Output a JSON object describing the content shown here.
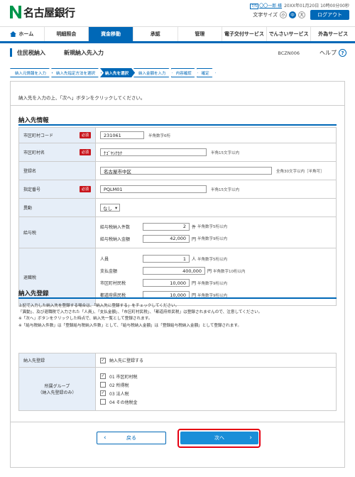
{
  "header": {
    "bank_name": "名古屋銀行",
    "user_tag": "7/5",
    "user_name": "〇〇一郎 様",
    "last_login": "20XX年01月20日 10時00分00秒",
    "font_size_label": "文字サイズ",
    "font_sizes": [
      "小",
      "中",
      "大"
    ],
    "logout": "ログアウト"
  },
  "gnav": [
    {
      "label": "ホーム",
      "icon": "home-icon"
    },
    {
      "label": "明細照会"
    },
    {
      "label": "資金移動"
    },
    {
      "label": "承認"
    },
    {
      "label": "管理"
    },
    {
      "label": "電子交付サービス"
    },
    {
      "label": "でんさいサービス"
    },
    {
      "label": "外為サービス"
    }
  ],
  "page": {
    "category": "住民税納入",
    "title": "新規納入先入力",
    "screen_id": "BCZN006",
    "help": "ヘルプ"
  },
  "steps": [
    "納入元情報を入力",
    "納入先指定方法を選択",
    "納入先を選択",
    "納入金額を入力",
    "内容確認",
    "確定"
  ],
  "instruction": "納入先を入力の上、「次へ」ボタンをクリックしてください。",
  "section1": {
    "title": "納入先情報",
    "required": "必須",
    "city_code": {
      "label": "市区町村コード",
      "value": "231061",
      "hint": "半角数字6桁"
    },
    "city_name": {
      "label": "市区町村名",
      "value": "ﾅｺﾞﾔｼﾅｶｸ",
      "hint": "半角15文字以内"
    },
    "registered_name": {
      "label": "登録名",
      "value": "名古屋市中区",
      "hint": "全角30文字以内［半角可］"
    },
    "designated_no": {
      "label": "指定番号",
      "value": "PQLM01",
      "hint": "半角15文字以内"
    },
    "transfer": {
      "label": "異動",
      "value": "なし"
    },
    "salary_tax": {
      "label": "給与税",
      "count_label": "給与税納入件数",
      "count_value": "2",
      "count_unit": "件",
      "count_hint": "半角数字5桁以内",
      "amount_label": "給与税納入金額",
      "amount_value": "42,000",
      "amount_unit": "円",
      "amount_hint": "半角数字9桁以内"
    },
    "retirement_tax": {
      "label": "退職税",
      "people_label": "人員",
      "people_value": "1",
      "people_unit": "人",
      "people_hint": "半角数字5桁以内",
      "paid_label": "支払金額",
      "paid_value": "400,000",
      "paid_unit": "円",
      "paid_hint": "半角数字10桁以内",
      "city_tax_label": "市区町村民税",
      "city_tax_value": "10,000",
      "city_tax_unit": "円",
      "city_tax_hint": "半角数字9桁以内",
      "pref_tax_label": "都道府県民税",
      "pref_tax_value": "10,000",
      "pref_tax_unit": "円",
      "pref_tax_hint": "半角数字9桁以内"
    }
  },
  "section2": {
    "title": "納入先登録",
    "notes": [
      "上記で入力した納入先を登録する場合は、「納入先に登録する」をチェックしてください。",
      "「異動」、及び退職税で入力された「人員」、「支払金額」、「市区町村民税」、「都道府県民税」は登録されませんので、注意してください。",
      "※「次へ」ボタンをクリックした時点で、納入先一覧として登録されます。",
      "※「給与税納入件数」は「登録給与税納入件数」として、「給与税納入金額」は「登録給与税納入金額」として登録されます。"
    ],
    "register": {
      "label": "納入先登録",
      "option": "納入先に登録する"
    },
    "group": {
      "label": "所属グループ",
      "sublabel": "（納入先登録のみ）",
      "options": [
        {
          "label": "01 市区町村税",
          "checked": true
        },
        {
          "label": "02 所得税",
          "checked": false
        },
        {
          "label": "03 法人税",
          "checked": true
        },
        {
          "label": "04 その他税金",
          "checked": false
        }
      ]
    }
  },
  "buttons": {
    "back": "戻る",
    "next": "次へ"
  },
  "colors": {
    "primary": "#0068b7",
    "required": "#c8161d",
    "highlight": "#e60012"
  }
}
